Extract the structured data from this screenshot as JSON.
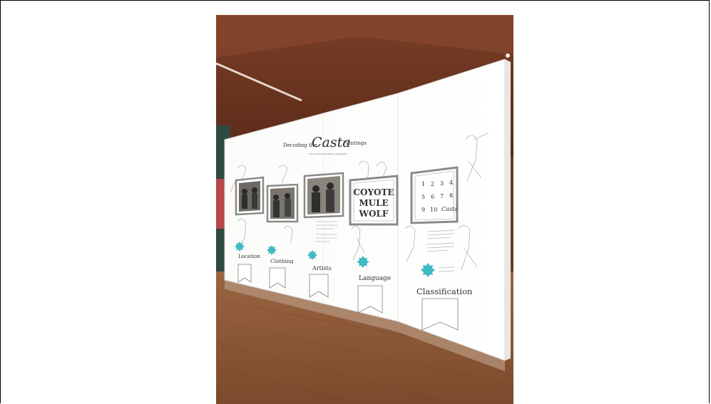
{
  "exhibit": {
    "title_prefix": "Decoding the",
    "title_script": "Casta",
    "title_suffix": "Paintings",
    "subtitle": "Can you find the hidden messages?",
    "panels": [
      {
        "label": "Location"
      },
      {
        "label": "Clothing"
      },
      {
        "label": "Artists"
      },
      {
        "label": "Language",
        "frame_words": [
          "COYOTE",
          "MULE",
          "WOLF"
        ]
      },
      {
        "label": "Classification",
        "frame_numbers": [
          "1",
          "2",
          "3",
          "4",
          "5",
          "6",
          "7",
          "8",
          "9",
          "10"
        ],
        "frame_script": "Casta"
      }
    ]
  }
}
